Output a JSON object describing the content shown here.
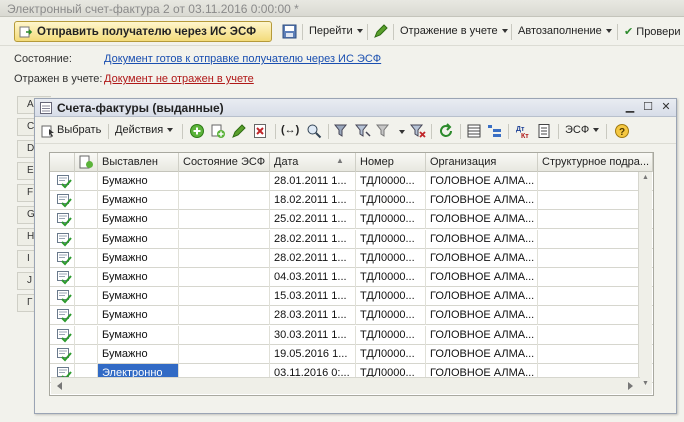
{
  "window": {
    "title": "Электронный счет-фактура 2 от 03.11.2016 0:00:00 *"
  },
  "toolbar": {
    "send_label": "Отправить получателю через ИС ЭСФ",
    "goto_label": "Перейти",
    "reflection_label": "Отражение в учете",
    "autofill_label": "Автозаполнение",
    "check_label": "Провери"
  },
  "form": {
    "state_label": "Состояние:",
    "state_value": "Документ готов к отправке получателю через ИС ЭСФ",
    "reflected_label": "Отражен в учете:",
    "reflected_value": "Документ не отражен в учете"
  },
  "left_tabs": [
    "А",
    "С",
    "D",
    "Е",
    "F",
    "G",
    "Н",
    "I",
    "J",
    "Г"
  ],
  "inner": {
    "title": "Счета-фактуры (выданные)",
    "select_label": "Выбрать",
    "actions_label": "Действия",
    "esf_label": "ЭСФ"
  },
  "table": {
    "columns": [
      "Выставлен",
      "Состояние ЭСФ",
      "Дата",
      "Номер",
      "Организация",
      "Структурное подра..."
    ],
    "rows": [
      {
        "issued": "Бумажно",
        "state": "",
        "date": "28.01.2011 1...",
        "number": "ТДЛ0000...",
        "org": "ГОЛОВНОЕ АЛМА..."
      },
      {
        "issued": "Бумажно",
        "state": "",
        "date": "18.02.2011 1...",
        "number": "ТДЛ0000...",
        "org": "ГОЛОВНОЕ АЛМА..."
      },
      {
        "issued": "Бумажно",
        "state": "",
        "date": "25.02.2011 1...",
        "number": "ТДЛ0000...",
        "org": "ГОЛОВНОЕ АЛМА..."
      },
      {
        "issued": "Бумажно",
        "state": "",
        "date": "28.02.2011 1...",
        "number": "ТДЛ0000...",
        "org": "ГОЛОВНОЕ АЛМА..."
      },
      {
        "issued": "Бумажно",
        "state": "",
        "date": "28.02.2011 1...",
        "number": "ТДЛ0000...",
        "org": "ГОЛОВНОЕ АЛМА..."
      },
      {
        "issued": "Бумажно",
        "state": "",
        "date": "04.03.2011 1...",
        "number": "ТДЛ0000...",
        "org": "ГОЛОВНОЕ АЛМА..."
      },
      {
        "issued": "Бумажно",
        "state": "",
        "date": "15.03.2011 1...",
        "number": "ТДЛ0000...",
        "org": "ГОЛОВНОЕ АЛМА..."
      },
      {
        "issued": "Бумажно",
        "state": "",
        "date": "28.03.2011 1...",
        "number": "ТДЛ0000...",
        "org": "ГОЛОВНОЕ АЛМА..."
      },
      {
        "issued": "Бумажно",
        "state": "",
        "date": "30.03.2011 1...",
        "number": "ТДЛ0000...",
        "org": "ГОЛОВНОЕ АЛМА..."
      },
      {
        "issued": "Бумажно",
        "state": "",
        "date": "19.05.2016 1...",
        "number": "ТДЛ0000...",
        "org": "ГОЛОВНОЕ АЛМА..."
      },
      {
        "issued": "Электронно",
        "state": "",
        "date": "03.11.2016 0:...",
        "number": "ТДЛ0000...",
        "org": "ГОЛОВНОЕ АЛМА..."
      }
    ]
  },
  "colors": {
    "accent_button": "#f3db7a",
    "selection": "#316ac5",
    "link": "#1a4fb0",
    "link_warning": "#b01818"
  }
}
